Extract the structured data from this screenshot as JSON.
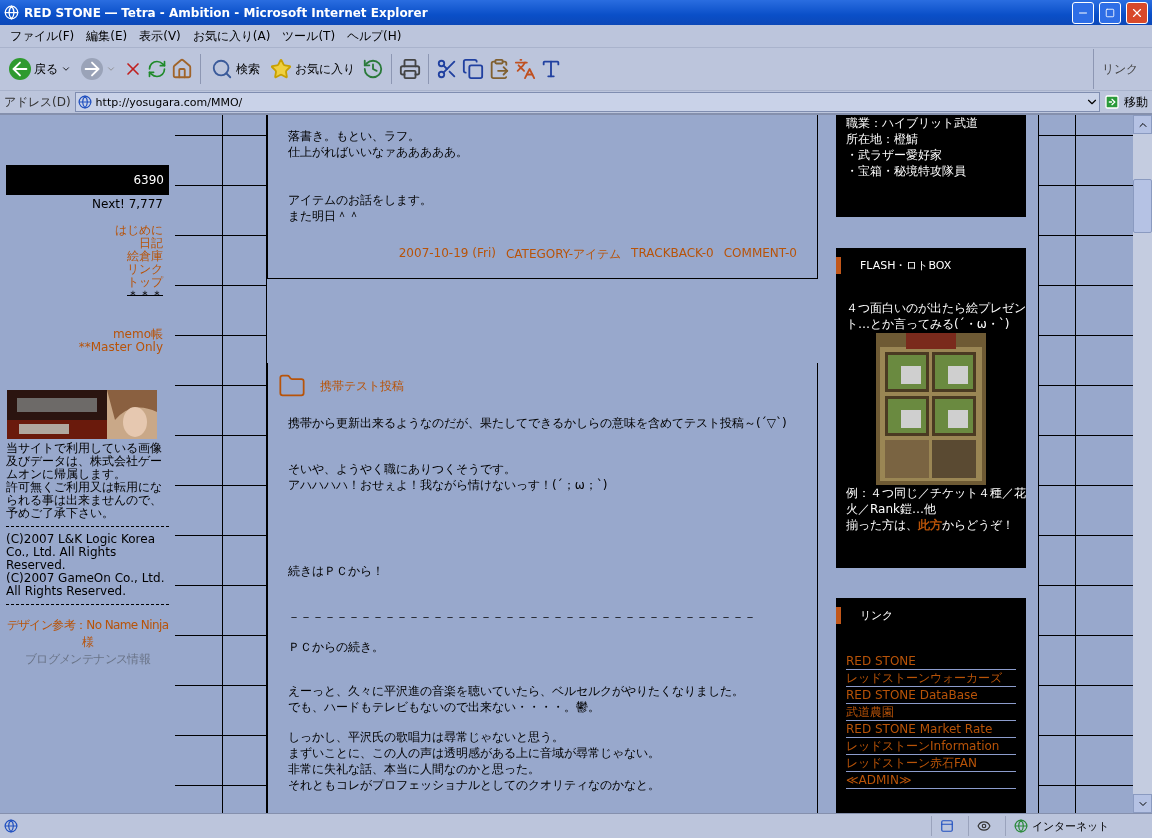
{
  "window": {
    "title": "RED STONE ― Tetra - Ambition - Microsoft Internet Explorer"
  },
  "menu": [
    "ファイル(F)",
    "編集(E)",
    "表示(V)",
    "お気に入り(A)",
    "ツール(T)",
    "ヘルプ(H)"
  ],
  "toolbar": {
    "back": "戻る",
    "search": "検索",
    "favorites": "お気に入り",
    "links": "リンク"
  },
  "address": {
    "label": "アドレス(D)",
    "url": "http://yosugara.com/MMO/",
    "go": "移動"
  },
  "sidebar": {
    "counter": "6390",
    "next": "Next! 7,777",
    "nav": [
      {
        "label": "はじめに",
        "kind": "link"
      },
      {
        "label": "日記",
        "kind": "link"
      },
      {
        "label": "絵倉庫",
        "kind": "link"
      },
      {
        "label": "リンク",
        "kind": "link"
      },
      {
        "label": "トップ",
        "kind": "link"
      },
      {
        "label": "＊＊＊",
        "kind": "struck"
      }
    ],
    "extra": [
      "memo帳",
      "**Master Only"
    ],
    "notice": [
      "当サイトで利用している画像及びデータは、株式会社ゲームオンに帰属します。",
      "許可無くご利用又は転用になられる事は出来ませんので、予めご了承下さい。"
    ],
    "copyright": [
      "(C)2007 L&K Logic Korea Co., Ltd. All Rights Reserved.",
      "(C)2007 GameOn Co., Ltd. All Rights Reserved."
    ],
    "design_credit": "デザイン参考：No Name Ninja様",
    "maintenance": "ブログメンテナンス情報"
  },
  "posts": [
    {
      "paragraphs": [
        [
          "落書き。もとい、ラフ。",
          "仕上がればいいなァあああああ。"
        ],
        [
          "アイテムのお話をします。",
          "また明日＾＾"
        ]
      ],
      "meta": [
        "2007-10-19 (Fri)",
        "CATEGORY-アイテム",
        "TRACKBACK-0",
        "COMMENT-0"
      ]
    },
    {
      "title": "携帯テスト投稿",
      "paragraphs": [
        [
          "携帯から更新出来るようなのだが、果たしてできるかしらの意味を含めてテスト投稿～(´▽`)"
        ],
        [
          "そいや、ようやく職にありつくそうです。",
          "アハハハハ！おせぇよ！我ながら情けないっす！(´；ω；`)"
        ],
        [
          "続きはＰＣから！"
        ],
        [
          "－－－－－－－－－－－－－－－－－－－－－－－－－－－－－－－－－－－－－－－"
        ],
        [
          "ＰＣからの続き。"
        ],
        [
          "えーっと、久々に平沢進の音楽を聴いていたら、ベルセルクがやりたくなりました。",
          "でも、ハードもテレビもないので出来ない・・・・。鬱。"
        ],
        [
          "しっかし、平沢氏の歌唱力は尋常じゃないと思う。",
          "まずいことに、この人の声は透明感がある上に音域が尋常じゃない。",
          "非常に失礼な話、本当に人間なのかと思った。",
          "それともコレがプロフェッショナルとしてのクオリティなのかなと。"
        ]
      ]
    }
  ],
  "profile": [
    "職業：ハイブリット武道",
    "所在地：橙鯖",
    "・武ラザー愛好家",
    "・宝箱・秘境特攻隊員"
  ],
  "flash_box": {
    "title": "FLASH・ロトBOX",
    "intro": "４つ面白いのが出たら絵プレゼント…とか言ってみる(´・ω・`)",
    "examples": "例：４つ同じ／チケット４種／花火／Rank鎧…他",
    "cta_prefix": "揃った方は、",
    "cta_link": "此方",
    "cta_suffix": "からどうぞ！"
  },
  "links_box": {
    "title": "リンク",
    "items": [
      "RED STONE",
      "レッドストーンウォーカーズ",
      "RED STONE DataBase",
      "武道農園",
      "RED STONE Market Rate",
      "レッドストーンInformation",
      "レッドストーン赤石FAN",
      "≪ADMIN≫"
    ]
  },
  "status_bar": {
    "zone": "インターネット"
  }
}
